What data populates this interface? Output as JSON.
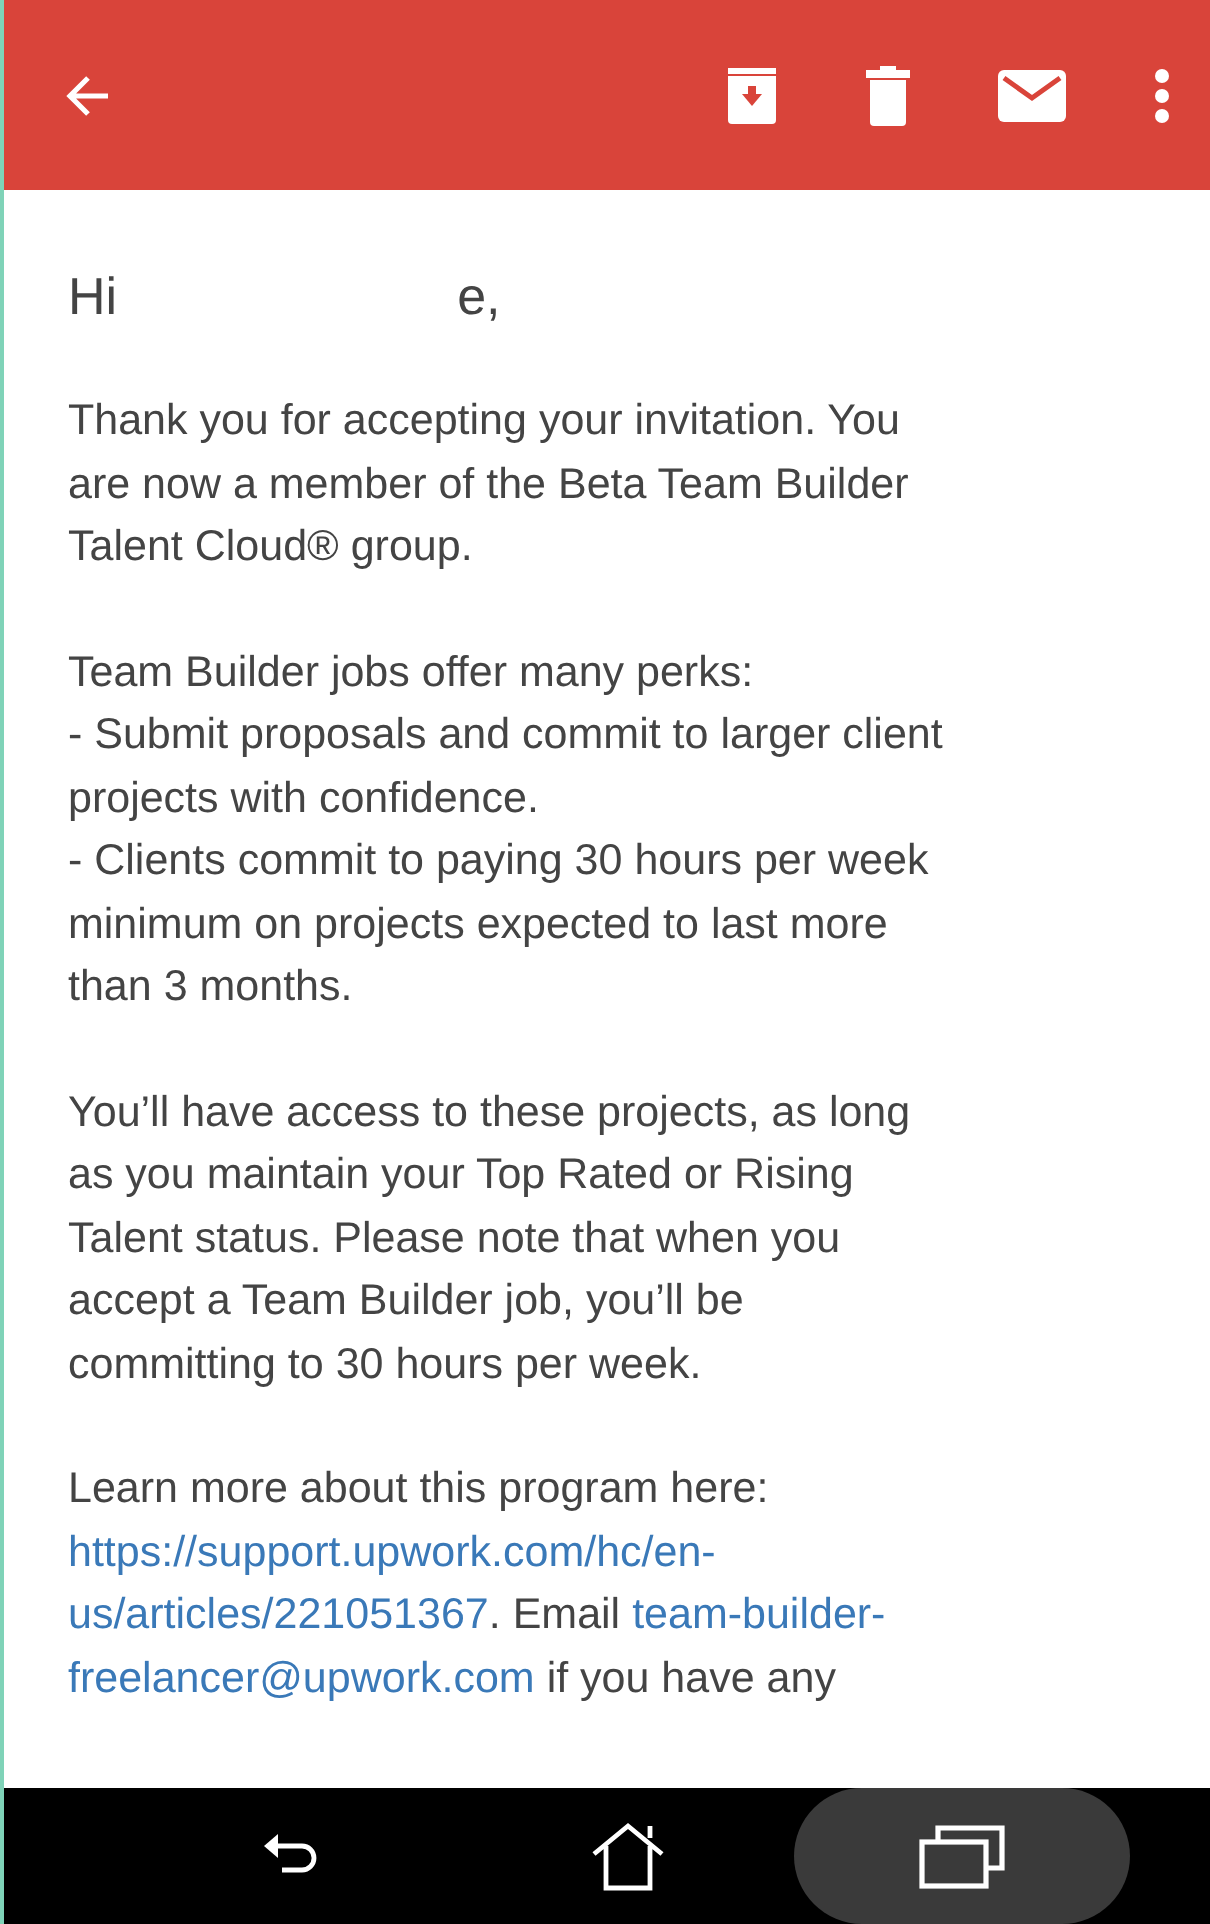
{
  "toolbar": {
    "actions": [
      {
        "kind": "archive"
      },
      {
        "kind": "delete"
      },
      {
        "kind": "mail"
      },
      {
        "kind": "more"
      }
    ]
  },
  "greeting": {
    "start": "Hi",
    "end": "e,"
  },
  "paragraphs": [
    [
      [
        {
          "kind": "text",
          "text": "Thank you for accepting your invitation. You"
        }
      ],
      [
        {
          "kind": "text",
          "text": "are now a member of the Beta Team Builder"
        }
      ],
      [
        {
          "kind": "text",
          "text": "Talent Cloud® group."
        }
      ]
    ],
    [
      [
        {
          "kind": "text",
          "text": "Team Builder jobs offer many perks:"
        }
      ],
      [
        {
          "kind": "text",
          "text": "- Submit proposals and commit to larger client"
        }
      ],
      [
        {
          "kind": "text",
          "text": "projects with confidence."
        }
      ],
      [
        {
          "kind": "text",
          "text": "- Clients commit to paying 30 hours per week"
        }
      ],
      [
        {
          "kind": "text",
          "text": "minimum on projects expected to last more"
        }
      ],
      [
        {
          "kind": "text",
          "text": "than 3 months."
        }
      ]
    ],
    [
      [
        {
          "kind": "text",
          "text": "You’ll have access to these projects, as long"
        }
      ],
      [
        {
          "kind": "text",
          "text": "as you maintain your Top Rated or Rising"
        }
      ],
      [
        {
          "kind": "text",
          "text": "Talent status. Please note that when you"
        }
      ],
      [
        {
          "kind": "text",
          "text": "accept a Team Builder job, you’ll be"
        }
      ],
      [
        {
          "kind": "text",
          "text": "committing to 30 hours per week."
        }
      ]
    ],
    [
      [
        {
          "kind": "text",
          "text": "Learn more about this program here:"
        }
      ],
      [
        {
          "kind": "link",
          "text": "https://support.upwork.com/hc/en-"
        }
      ],
      [
        {
          "kind": "link",
          "text": "us/articles/221051367"
        },
        {
          "kind": "text",
          "text": ". Email "
        },
        {
          "kind": "link",
          "text": "team-builder-"
        }
      ],
      [
        {
          "kind": "link",
          "text": "freelancer@upwork.com"
        },
        {
          "kind": "text",
          "text": " if you have any"
        }
      ]
    ]
  ],
  "nav_bar": {
    "buttons": [
      {
        "kind": "back",
        "selected": false
      },
      {
        "kind": "home",
        "selected": false
      },
      {
        "kind": "recents",
        "selected": true
      }
    ]
  }
}
